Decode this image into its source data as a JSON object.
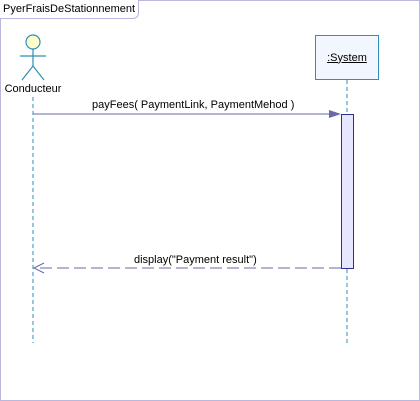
{
  "frame": {
    "title": "PyerFraisDeStationnement"
  },
  "actor": {
    "name": "Conducteur"
  },
  "system": {
    "name": ":System"
  },
  "messages": [
    {
      "label": "payFees( PaymentLink, PaymentMehod )",
      "kind": "synchronous call"
    },
    {
      "label": "display(\"Payment result\")",
      "kind": "return"
    }
  ],
  "colors": {
    "frame_border": "#b8b8e0",
    "lifeline": "#2f8fb8",
    "message_line": "#6a6aa8",
    "activation_fill": "#e6e6ff",
    "activation_border": "#2f2f8f",
    "actor_head_fill": "#ffffcc"
  }
}
